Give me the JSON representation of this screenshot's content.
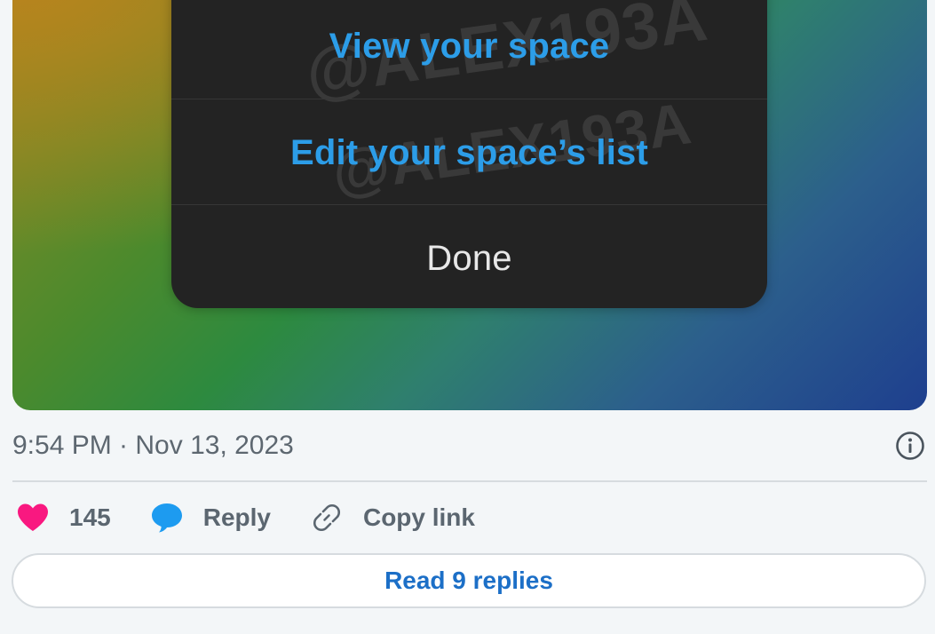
{
  "sheet": {
    "view_space_label": "View your space",
    "edit_list_label": "Edit your space’s list",
    "done_label": "Done",
    "watermark_text": "@ALEX193A"
  },
  "tweet": {
    "timestamp": "9:54 PM · Nov 13, 2023",
    "likes_count": "145",
    "reply_label": "Reply",
    "copy_link_label": "Copy link",
    "read_replies_label": "Read 9 replies"
  },
  "icons": {
    "heart": "heart-icon",
    "reply": "speech-bubble-icon",
    "link": "link-icon",
    "info": "info-icon"
  },
  "colors": {
    "heart": "#f91880",
    "reply_bubble": "#1d9bf0",
    "sheet_action": "#2c9de8",
    "read_replies": "#1c6fc7"
  }
}
